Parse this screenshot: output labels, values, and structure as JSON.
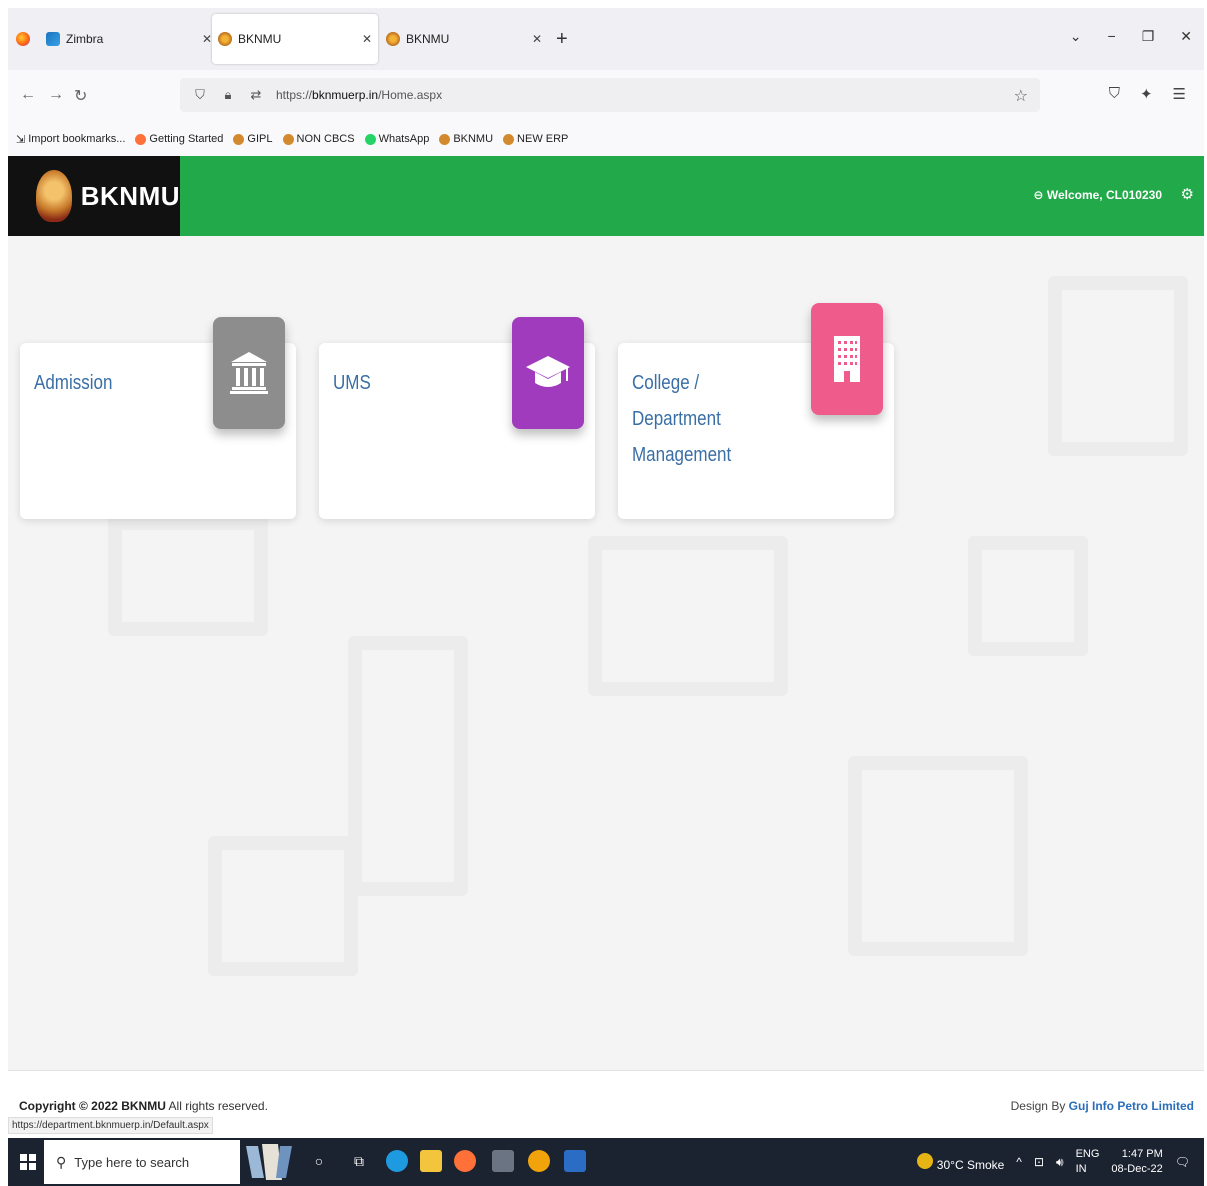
{
  "browser": {
    "tabs": [
      {
        "title": "Zimbra",
        "favicon": "zimbra-icon",
        "active": false
      },
      {
        "title": "BKNMU",
        "favicon": "bknmu-icon",
        "active": true
      },
      {
        "title": "BKNMU",
        "favicon": "bknmu-icon",
        "active": false
      }
    ],
    "new_tab": "+",
    "url_prefix": "https://",
    "url_host": "bknmuerp.in",
    "url_path": "/Home.aspx",
    "bookmarks": [
      {
        "label": "Import bookmarks...",
        "color": "#555555"
      },
      {
        "label": "Getting Started",
        "color": "#ff7139"
      },
      {
        "label": "GIPL",
        "color": "#d38a2e"
      },
      {
        "label": "NON CBCS",
        "color": "#d38a2e"
      },
      {
        "label": "WhatsApp",
        "color": "#25d366"
      },
      {
        "label": "BKNMU",
        "color": "#d38a2e"
      },
      {
        "label": "NEW ERP",
        "color": "#d38a2e"
      }
    ]
  },
  "header": {
    "brand": "BKNMU",
    "welcome": "Welcome, CL010230",
    "bg_color": "#22a94a"
  },
  "cards": [
    {
      "label": "Admission",
      "icon": "bank-building-icon",
      "color": "#8d8d8d"
    },
    {
      "label": "UMS",
      "icon": "graduation-cap-icon",
      "color": "#a13bbd"
    },
    {
      "label": "College / Department Management",
      "icon": "office-building-icon",
      "color": "#ef5c8c"
    }
  ],
  "footer": {
    "copyright_bold": "Copyright © 2022 BKNMU",
    "copyright_rest": " All rights reserved.",
    "design_prefix": "Design By ",
    "design_link": "Guj Info Petro Limited",
    "status_url": "https://department.bknmuerp.in/Default.aspx"
  },
  "taskbar": {
    "search_placeholder": "Type here to search",
    "weather": "30°C  Smoke",
    "lang_top": "ENG",
    "lang_bottom": "IN",
    "time": "1:47 PM",
    "date": "08-Dec-22"
  }
}
